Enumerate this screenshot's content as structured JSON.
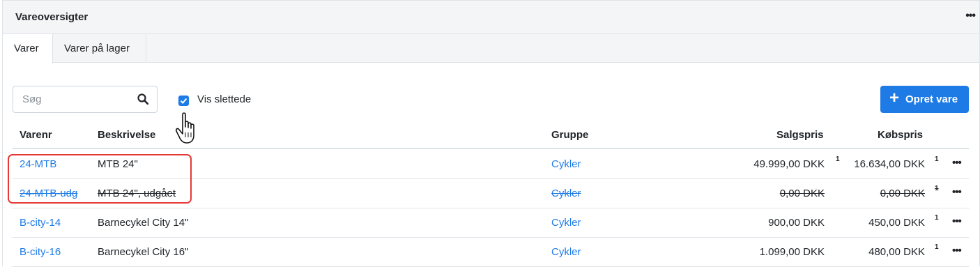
{
  "panel": {
    "title": "Vareoversigter",
    "menu_icon": "more-horizontal-icon",
    "menu_glyph": "•••"
  },
  "tabs": [
    {
      "label": "Varer",
      "active": true
    },
    {
      "label": "Varer på lager",
      "active": false
    }
  ],
  "toolbar": {
    "search_placeholder": "Søg",
    "search_value": "",
    "search_icon": "search-icon",
    "show_deleted_label": "Vis slettede",
    "show_deleted_checked": true,
    "create_plus": "+",
    "create_label": "Opret vare",
    "accent_color": "#1e7be6"
  },
  "table": {
    "headers": {
      "varenr": "Varenr",
      "beskrivelse": "Beskrivelse",
      "gruppe": "Gruppe",
      "salgspris": "Salgspris",
      "kobspris": "Købspris"
    },
    "rows": [
      {
        "varenr": "24-MTB",
        "beskrivelse": "MTB 24\"",
        "gruppe": "Cykler",
        "salgspris": "49.999,00 DKK",
        "salg_sup": "1",
        "kobspris": "16.634,00 DKK",
        "kob_sup": "1",
        "menu": "•••",
        "deleted": false
      },
      {
        "varenr": "24-MTB-udg",
        "beskrivelse": "MTB 24\", udgået",
        "gruppe": "Cykler",
        "salgspris": "0,00 DKK",
        "salg_sup": "",
        "kobspris": "0,00 DKK",
        "kob_sup": "1",
        "menu": "•••",
        "deleted": true
      },
      {
        "varenr": "B-city-14",
        "beskrivelse": "Barnecykel City 14\"",
        "gruppe": "Cykler",
        "salgspris": "900,00 DKK",
        "salg_sup": "",
        "kobspris": "450,00 DKK",
        "kob_sup": "1",
        "menu": "•••",
        "deleted": false
      },
      {
        "varenr": "B-city-16",
        "beskrivelse": "Barnecykel City 16\"",
        "gruppe": "Cykler",
        "salgspris": "1.099,00 DKK",
        "salg_sup": "",
        "kobspris": "480,00 DKK",
        "kob_sup": "1",
        "menu": "•••",
        "deleted": false
      }
    ]
  },
  "annotation": {
    "highlight_color": "#e53935",
    "cursor_icon": "hand-pointer-icon"
  }
}
